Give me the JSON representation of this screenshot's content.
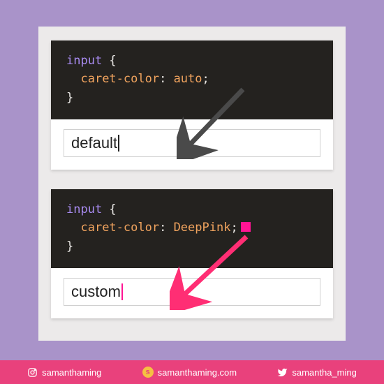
{
  "examples": [
    {
      "selector": "input",
      "property": "caret-color",
      "value": "auto",
      "swatch": false,
      "input_text": "default",
      "caret_class": "caret-default",
      "arrow_color": "#4a4a4a"
    },
    {
      "selector": "input",
      "property": "caret-color",
      "value": "DeepPink",
      "swatch": true,
      "input_text": "custom",
      "caret_class": "caret-pink",
      "arrow_color": "#ff2e74"
    }
  ],
  "footer": {
    "instagram": "samanthaming",
    "website": "samanthaming.com",
    "twitter": "samantha_ming"
  },
  "colors": {
    "bg": "#a993c9",
    "canvas": "#eceaea",
    "code_bg": "#24221f",
    "footer_bg": "#e9417c",
    "accent_yellow": "#f6c042",
    "deeppink": "#ff1493"
  }
}
